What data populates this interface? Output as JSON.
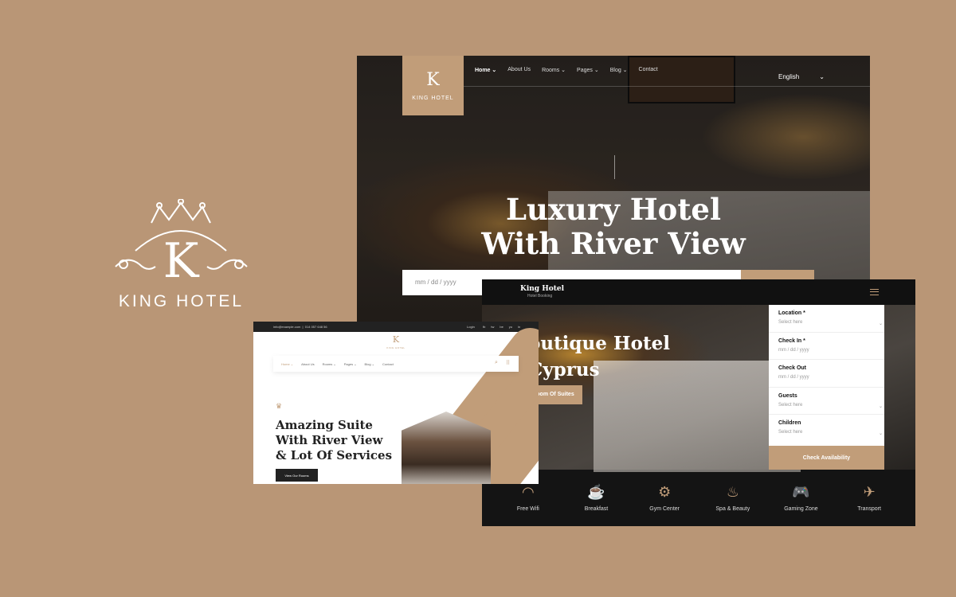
{
  "brand": {
    "name": "KING HOTEL",
    "monogram": "K"
  },
  "main": {
    "logo": {
      "monogram": "K",
      "name": "KING HOTEL"
    },
    "nav": [
      {
        "label": "Home ⌄"
      },
      {
        "label": "About Us"
      },
      {
        "label": "Rooms ⌄"
      },
      {
        "label": "Pages ⌄"
      },
      {
        "label": "Blog ⌄"
      },
      {
        "label": "Contact"
      }
    ],
    "language": "English",
    "language_chevron": "⌄",
    "hero_title_1": "Luxury Hotel",
    "hero_title_2": "With River View",
    "date_placeholder": "mm / dd / yyyy"
  },
  "booking": {
    "brand": "King Hotel",
    "tagline": "Hotel Booking",
    "hero_title_1": "outique Hotel",
    "hero_title_2": "Cyprus",
    "hero_button": "oom Of Suites",
    "form": [
      {
        "label": "Location *",
        "value": "Select here",
        "chevron": "⌄"
      },
      {
        "label": "Check In *",
        "value": "mm / dd / yyyy",
        "chevron": ""
      },
      {
        "label": "Check Out",
        "value": "mm / dd / yyyy",
        "chevron": ""
      },
      {
        "label": "Guests",
        "value": "Select here",
        "chevron": "⌄"
      },
      {
        "label": "Children",
        "value": "Select here",
        "chevron": "⌄"
      }
    ],
    "submit": "Check Availability",
    "amenities": [
      {
        "icon": "wifi-icon",
        "glyph": "◠",
        "label": "Free Wifi"
      },
      {
        "icon": "breakfast-icon",
        "glyph": "☕",
        "label": "Breakfast"
      },
      {
        "icon": "gym-icon",
        "glyph": "⚙",
        "label": "Gym Center"
      },
      {
        "icon": "spa-icon",
        "glyph": "♨",
        "label": "Spa & Beauty"
      },
      {
        "icon": "gamepad-icon",
        "glyph": "🎮",
        "label": "Gaming Zone"
      },
      {
        "icon": "airplane-icon",
        "glyph": "✈",
        "label": "Transport"
      }
    ]
  },
  "suite": {
    "email": "info@example.com",
    "phone": "014 057 648 56",
    "login": "Login",
    "social": [
      "fb",
      "tw",
      "be",
      "yu",
      "in"
    ],
    "logo": {
      "monogram": "K",
      "name": "KING HOTEL"
    },
    "nav": [
      {
        "label": "Home ⌄"
      },
      {
        "label": "About Us"
      },
      {
        "label": "Rooms ⌄"
      },
      {
        "label": "Pages ⌄"
      },
      {
        "label": "Blog ⌄"
      },
      {
        "label": "Contact"
      }
    ],
    "title_1": "Amazing Suite",
    "title_2": "With River View",
    "title_3": "& Lot Of Services",
    "button": "View Our Rooms"
  },
  "colors": {
    "accent": "#c19d79",
    "background": "#b99676",
    "dark": "#141414"
  }
}
